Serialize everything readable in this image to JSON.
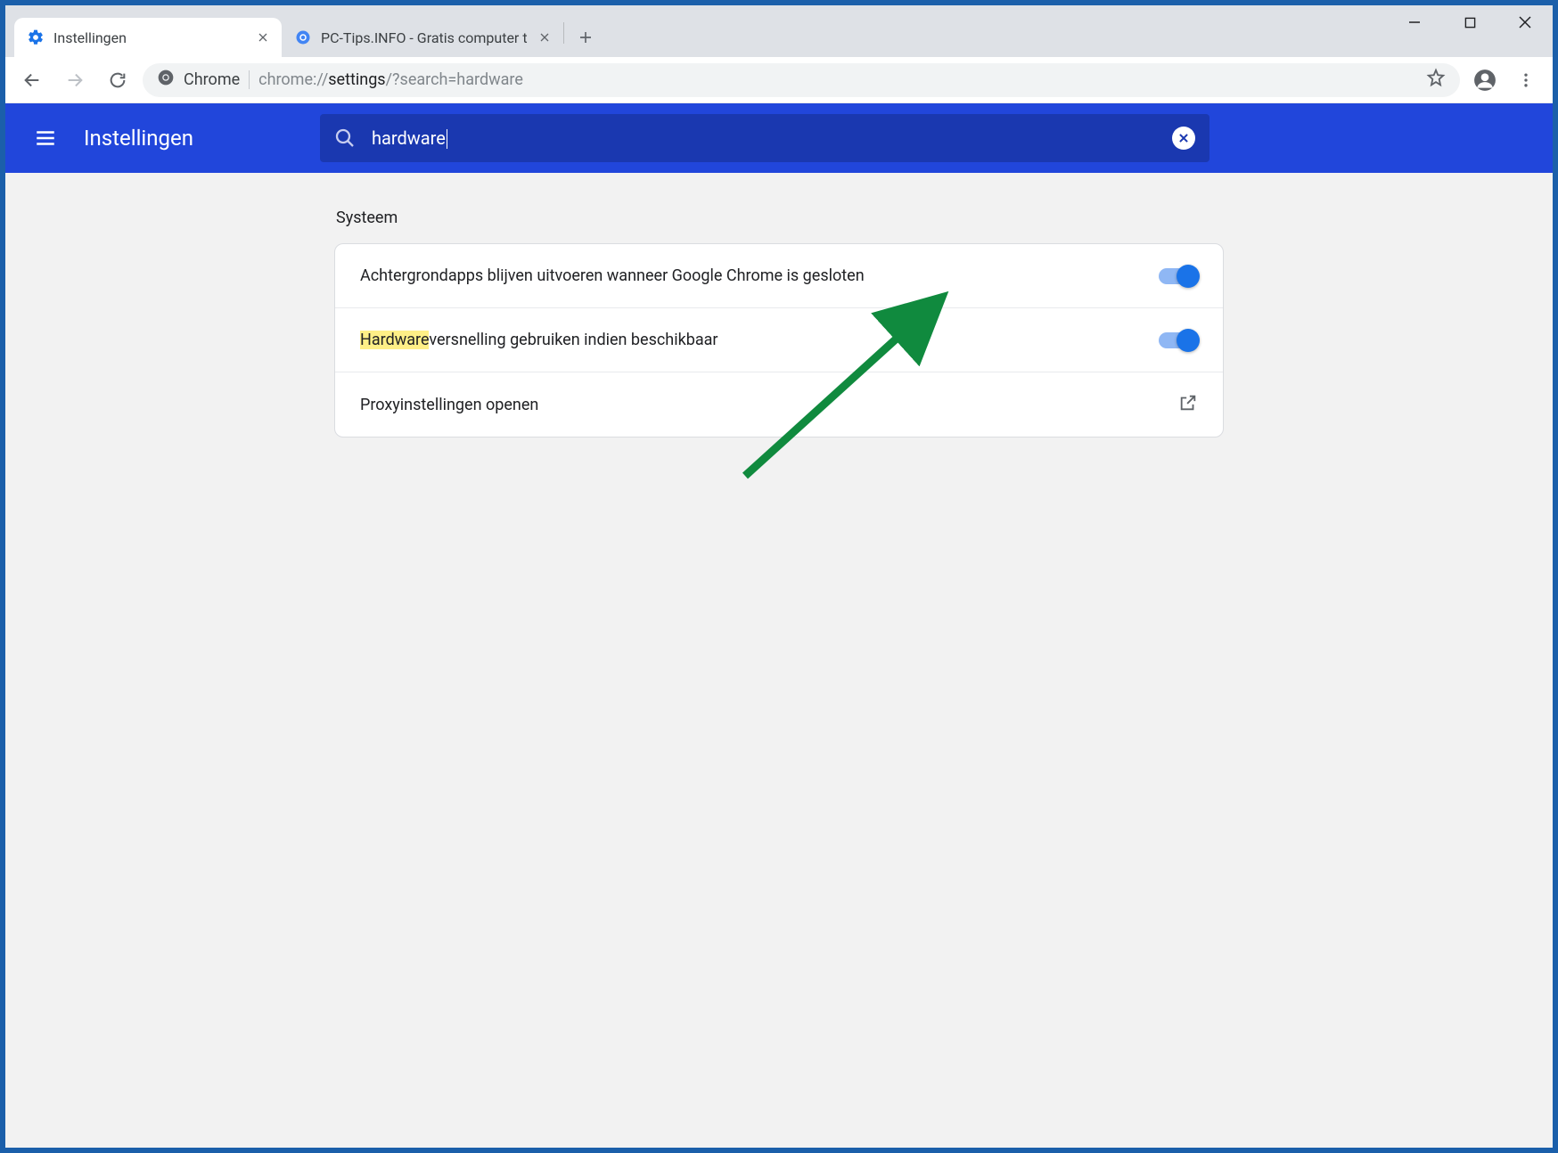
{
  "tabs": [
    {
      "title": "Instellingen"
    },
    {
      "title": "PC-Tips.INFO - Gratis computer t"
    }
  ],
  "omnibox": {
    "chip": "Chrome",
    "url_prefix": "chrome://",
    "url_strong": "settings",
    "url_suffix": "/?search=hardware"
  },
  "app": {
    "title": "Instellingen",
    "search_query": "hardware"
  },
  "section": {
    "title": "Systeem",
    "rows": [
      {
        "label": "Achtergrondapps blijven uitvoeren wanneer Google Chrome is gesloten",
        "toggle": true
      },
      {
        "highlight": "Hardware",
        "label_rest": "versnelling gebruiken indien beschikbaar",
        "toggle": true
      },
      {
        "label": "Proxyinstellingen openen",
        "external": true
      }
    ]
  }
}
